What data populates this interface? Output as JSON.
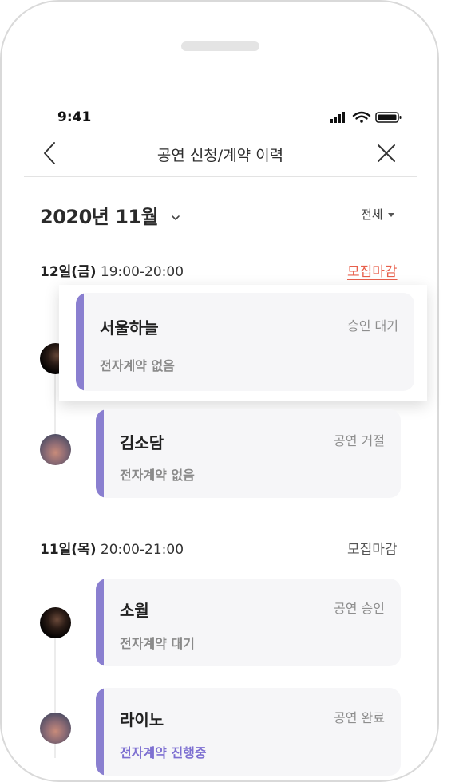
{
  "status_bar": {
    "time": "9:41"
  },
  "nav": {
    "title": "공연 신청/계약 이력"
  },
  "header": {
    "month": "2020년 11월",
    "filter": "전체"
  },
  "colors": {
    "accent": "#8a7fd0",
    "closed_red": "#e8604c"
  },
  "groups": [
    {
      "date": "12일(금)",
      "time": "19:00-20:00",
      "status": "모집마감",
      "items": [
        {
          "name": "서울하늘",
          "state": "승인 대기",
          "contract": "전자계약 없음"
        },
        {
          "name": "김소담",
          "state": "공연 거절",
          "contract": "전자계약 없음"
        }
      ]
    },
    {
      "date": "11일(목)",
      "time": "20:00-21:00",
      "status": "모집마감",
      "items": [
        {
          "name": "소월",
          "state": "공연 승인",
          "contract": "전자계약 대기"
        },
        {
          "name": "라이노",
          "state": "공연 완료",
          "contract": "전자계약 진행중"
        }
      ]
    }
  ]
}
